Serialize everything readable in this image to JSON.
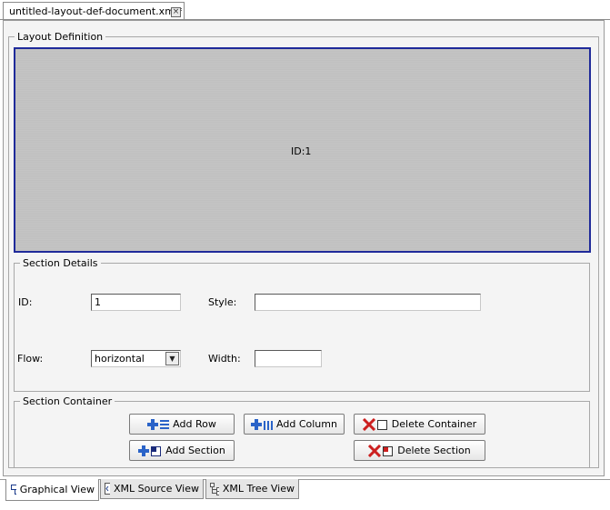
{
  "document_tab": {
    "title": "untitled-layout-def-document.xml*",
    "close_glyph": "×"
  },
  "layout_definition": {
    "legend": "Layout Definition",
    "canvas": {
      "section_label": "ID:1",
      "border_color": "#1f2a9a",
      "fill_color": "#c0c0c0"
    }
  },
  "section_details": {
    "legend": "Section Details",
    "id_label": "ID:",
    "id_value": "1",
    "style_label": "Style:",
    "style_value": "",
    "flow_label": "Flow:",
    "flow_value": "horizontal",
    "width_label": "Width:",
    "width_value": ""
  },
  "section_container": {
    "legend": "Section Container",
    "buttons": {
      "add_row": "Add Row",
      "add_column": "Add Column",
      "delete_container": "Delete Container",
      "add_section": "Add Section",
      "delete_section": "Delete Section"
    }
  },
  "view_tabs": {
    "graphical": "Graphical View",
    "xml_source": "XML Source View",
    "xml_tree": "XML Tree View",
    "active": "graphical"
  },
  "icons": {
    "add": "plus-icon",
    "delete": "x-icon",
    "add_color": "#2a63c8",
    "delete_color": "#cc1f1f"
  }
}
